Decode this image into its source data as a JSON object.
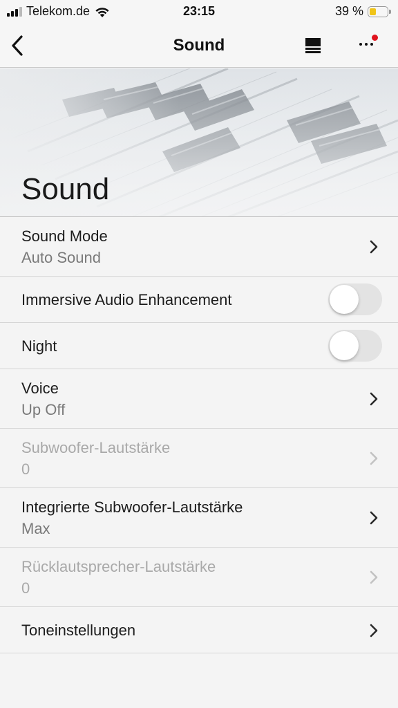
{
  "status_bar": {
    "carrier": "Telekom.de",
    "time": "23:15",
    "battery_percent": "39 %",
    "battery_level": 0.39,
    "battery_color": "#f0c419"
  },
  "nav": {
    "title": "Sound",
    "icons": [
      "back-icon",
      "now-playing-icon",
      "more-icon"
    ],
    "badge_color": "#e0141e"
  },
  "hero": {
    "title": "Sound"
  },
  "settings": [
    {
      "label": "Sound Mode",
      "value": "Auto Sound",
      "control": "chevron",
      "enabled": true
    },
    {
      "label": "Immersive Audio Enhancement",
      "control": "toggle",
      "on": false,
      "enabled": true
    },
    {
      "label": "Night",
      "control": "toggle",
      "on": false,
      "enabled": true
    },
    {
      "label": "Voice",
      "value": "Up Off",
      "control": "chevron",
      "enabled": true
    },
    {
      "label": "Subwoofer-Lautstärke",
      "value": "0",
      "control": "chevron",
      "enabled": false
    },
    {
      "label": "Integrierte Subwoofer-Lautstärke",
      "value": "Max",
      "control": "chevron",
      "enabled": true
    },
    {
      "label": "Rücklautsprecher-Lautstärke",
      "value": "0",
      "control": "chevron",
      "enabled": false
    },
    {
      "label": "Toneinstellungen",
      "control": "chevron",
      "enabled": true
    }
  ]
}
